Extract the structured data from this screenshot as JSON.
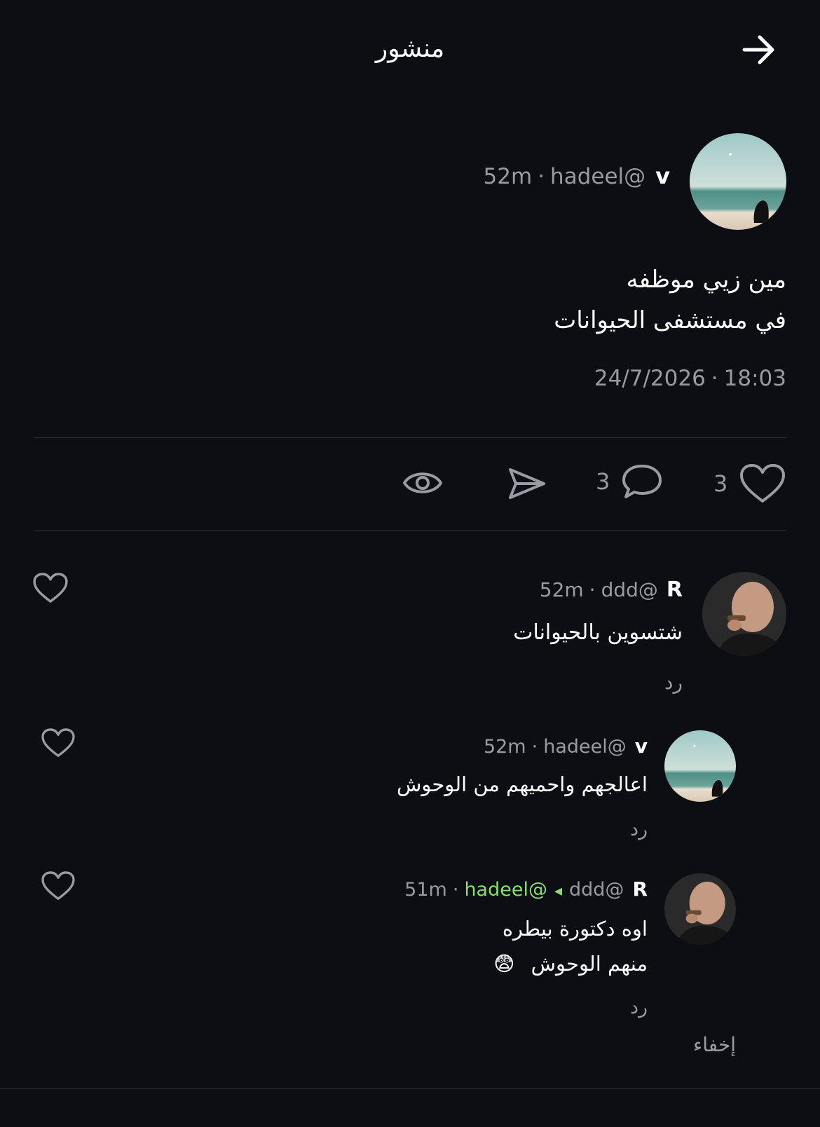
{
  "header": {
    "title": "منشور",
    "back_icon": "arrow-right-icon"
  },
  "post": {
    "author_name": "v",
    "handle": "hadeel@",
    "time_ago": "52m",
    "text_line1": "مين زيي موظفه",
    "text_line2": "في مستشفى الحيوانات",
    "time": "18:03",
    "date": "24/7/2026",
    "likes": "3",
    "comments": "3"
  },
  "comments": [
    {
      "author_name": "R",
      "handle": "ddd@",
      "time_ago": "52m",
      "text_line1": "شتسوين بالحيوانات",
      "reply_label": "رد"
    },
    {
      "author_name": "v",
      "handle": "hadeel@",
      "time_ago": "52m",
      "text_line1": "اعالجهم واحميهم من الوحوش",
      "reply_label": "رد"
    },
    {
      "author_name": "R",
      "handle": "ddd@",
      "reply_to": "hadeel@",
      "reply_arrow": "◂",
      "time_ago": "51m",
      "text_line1": "اوه دكتورة بيطره",
      "text_line2": "منهم الوحوش",
      "emoji": "😨",
      "reply_label": "رد"
    }
  ],
  "hide_label": "إخفاء",
  "colors": {
    "background": "#0d0d14",
    "text_primary": "#ffffff",
    "text_secondary": "#9a9aa3",
    "mention_green": "#86e06c",
    "divider": "#2c2c34"
  }
}
